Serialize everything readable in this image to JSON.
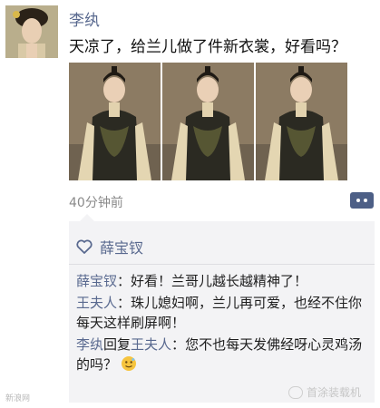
{
  "post": {
    "username": "李纨",
    "text": "天凉了，给兰儿做了件新衣裳，好看吗？",
    "time": "40分钟前",
    "photo_count": 3
  },
  "likes": {
    "names": "薛宝钗"
  },
  "comments": [
    {
      "author": "薛宝钗",
      "sep": "：",
      "text": "好看！兰哥儿越长越精神了！"
    },
    {
      "author": "王夫人",
      "sep": "：",
      "text": "珠儿媳妇啊，兰儿再可爱，也经不住你每天这样刷屏啊！"
    },
    {
      "author": "李纨",
      "reply_word": "回复",
      "reply_to": "王夫人",
      "sep": "：",
      "text": "您不也每天发佛经呀心灵鸡汤的吗？"
    }
  ],
  "watermarks": {
    "left": "新浪网",
    "right": "首涂装载机"
  },
  "colors": {
    "name_blue": "#59698f",
    "panel_bg": "#f3f3f5",
    "more_button": "#4d5f86"
  },
  "icons": [
    "avatar",
    "heart-icon",
    "more-icon",
    "emoji-icon"
  ]
}
